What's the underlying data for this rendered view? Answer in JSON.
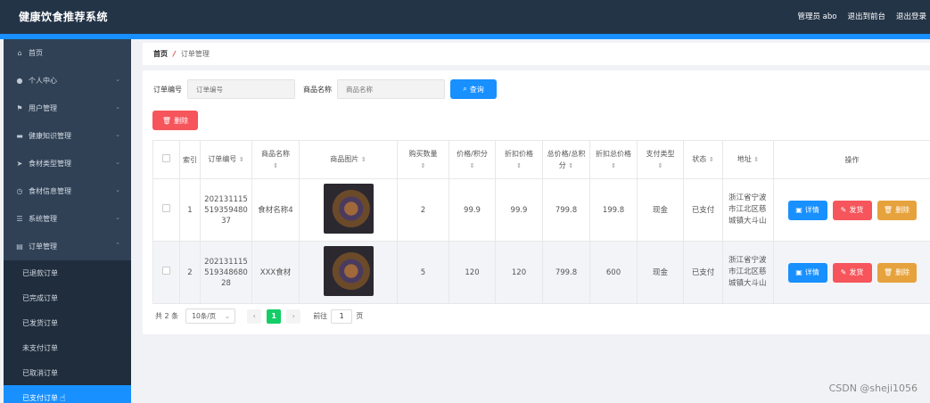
{
  "header": {
    "title": "健康饮食推荐系统",
    "user": "管理员 abo",
    "back_front": "退出到前台",
    "logout": "退出登录"
  },
  "sidebar": {
    "items": [
      {
        "icon": "home-icon",
        "label": "首页"
      },
      {
        "icon": "user-icon",
        "label": "个人中心"
      },
      {
        "icon": "flag-icon",
        "label": "用户管理"
      },
      {
        "icon": "book-icon",
        "label": "健康知识管理"
      },
      {
        "icon": "send-icon",
        "label": "食材类型管理"
      },
      {
        "icon": "clock-icon",
        "label": "食材信息管理"
      },
      {
        "icon": "menu-icon",
        "label": "系统管理"
      },
      {
        "icon": "doc-icon",
        "label": "订单管理"
      }
    ],
    "sub_items": [
      {
        "label": "已退款订单"
      },
      {
        "label": "已完成订单"
      },
      {
        "label": "已发货订单"
      },
      {
        "label": "未支付订单"
      },
      {
        "label": "已取消订单"
      },
      {
        "label": "已支付订单"
      }
    ]
  },
  "breadcrumb": {
    "home": "首页",
    "sep": "/",
    "current": "订单管理"
  },
  "search": {
    "order_no_label": "订单编号",
    "order_no_placeholder": "订单编号",
    "product_label": "商品名称",
    "product_placeholder": "商品名称",
    "query_button": "查询"
  },
  "toolbar": {
    "delete_button": "删除"
  },
  "table": {
    "headers": [
      "索引",
      "订单编号",
      "商品名称",
      "商品图片",
      "购买数量",
      "价格/积分",
      "折扣价格",
      "总价格/总积分",
      "折扣总价格",
      "支付类型",
      "状态",
      "地址",
      "操作"
    ],
    "rows": [
      {
        "index": "1",
        "order_no": "202131115519359480 37",
        "product": "食材名称4",
        "qty": "2",
        "price": "99.9",
        "discount": "99.9",
        "total": "799.8",
        "discount_total": "199.8",
        "pay_type": "现金",
        "status": "已支付",
        "address": "浙江省宁波市江北区慈城镇大斗山"
      },
      {
        "index": "2",
        "order_no": "202131115519348680 28",
        "product": "XXX食材",
        "qty": "5",
        "price": "120",
        "discount": "120",
        "total": "799.8",
        "discount_total": "600",
        "pay_type": "现金",
        "status": "已支付",
        "address": "浙江省宁波市江北区慈城镇大斗山"
      }
    ],
    "ops": {
      "detail": "详情",
      "ship": "发货",
      "delete": "删除"
    }
  },
  "pagination": {
    "total": "共 2 条",
    "page_size": "10条/页",
    "current_page": "1",
    "goto_label": "前往",
    "goto_value": "1",
    "page_unit": "页"
  },
  "watermark": "CSDN @sheji1056"
}
